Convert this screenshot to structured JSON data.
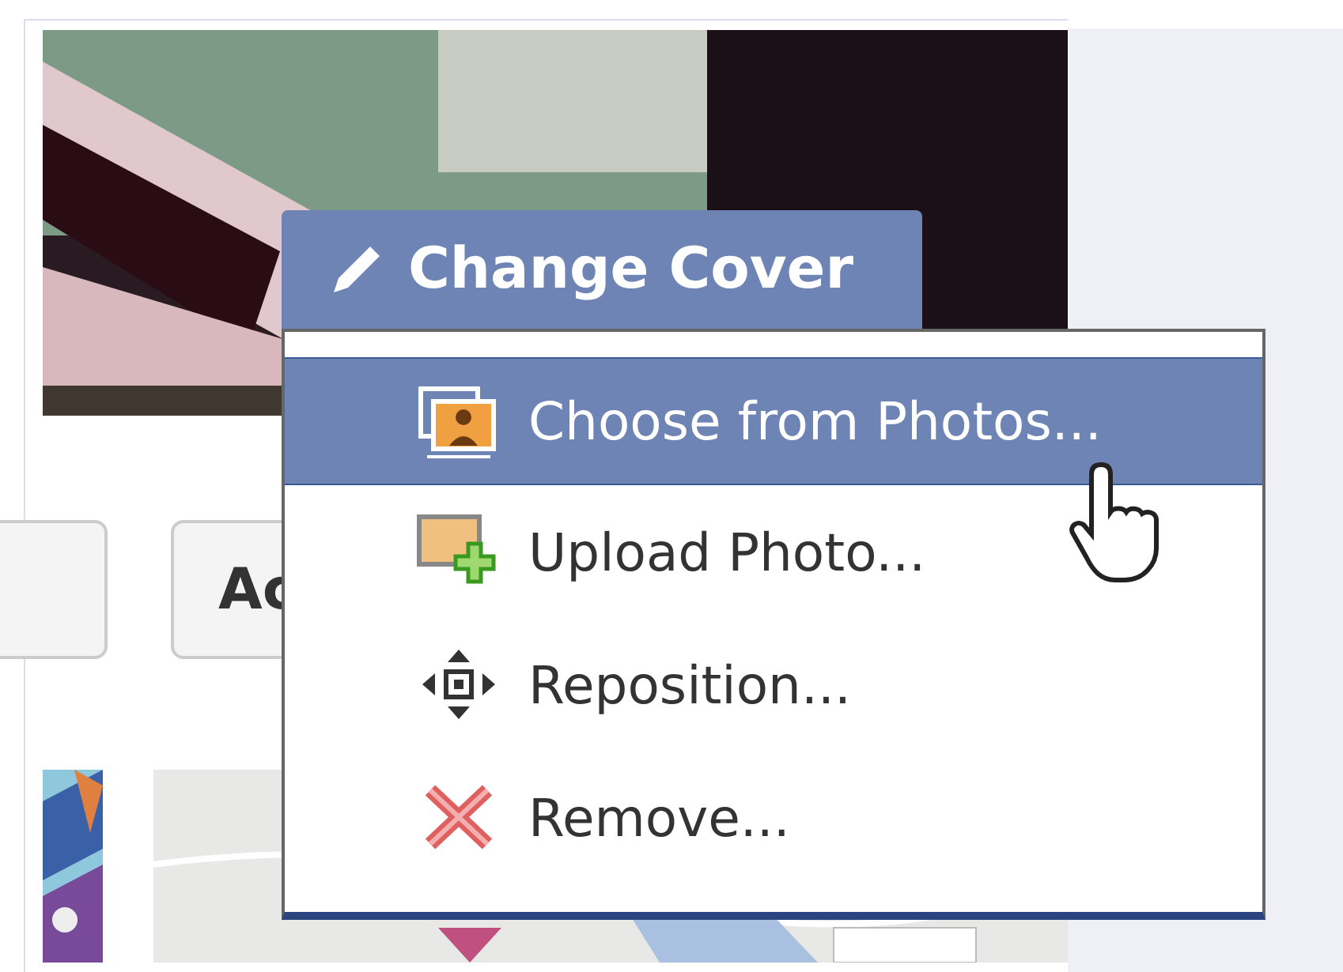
{
  "cover_button": {
    "label": "Change Cover"
  },
  "menu": {
    "items": [
      {
        "label": "Choose from Photos...",
        "kind": "choose",
        "selected": true
      },
      {
        "label": "Upload Photo...",
        "kind": "upload",
        "selected": false
      },
      {
        "label": "Reposition...",
        "kind": "reposition",
        "selected": false
      },
      {
        "label": "Remove...",
        "kind": "remove",
        "selected": false
      }
    ]
  },
  "action_button": {
    "label": "Ac"
  }
}
